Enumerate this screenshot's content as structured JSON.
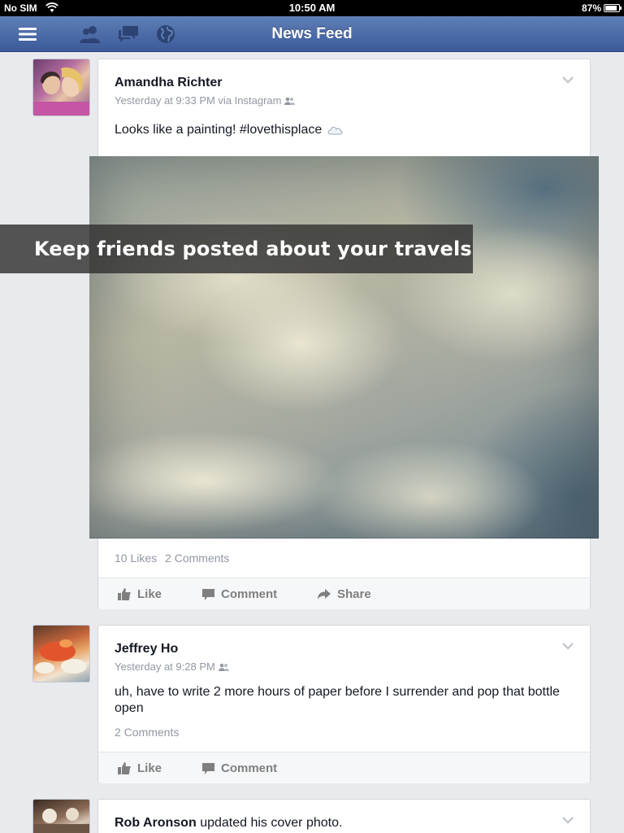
{
  "status_bar": {
    "carrier": "No SIM",
    "time": "10:50 AM",
    "battery": "87%"
  },
  "navbar": {
    "title": "News Feed"
  },
  "overlay": {
    "text": "Keep friends posted about your travels"
  },
  "posts": [
    {
      "author": "Amandha Richter",
      "meta": "Yesterday at 9:33 PM via Instagram",
      "text": "Looks like a painting! #lovethisplace",
      "likes": "10 Likes",
      "comments": "2 Comments",
      "actions": {
        "like": "Like",
        "comment": "Comment",
        "share": "Share"
      }
    },
    {
      "author": "Jeffrey Ho",
      "meta": "Yesterday at 9:28 PM",
      "text": "uh, have to write 2 more hours of paper before I surrender and pop that bottle open",
      "comments": "2 Comments",
      "actions": {
        "like": "Like",
        "comment": "Comment"
      }
    },
    {
      "author": "Rob Aronson",
      "story": "updated his cover photo."
    }
  ],
  "colors": {
    "brand_blue": "#3b5998",
    "feed_bg": "#e9eaed",
    "meta_grey": "#9197a3"
  }
}
